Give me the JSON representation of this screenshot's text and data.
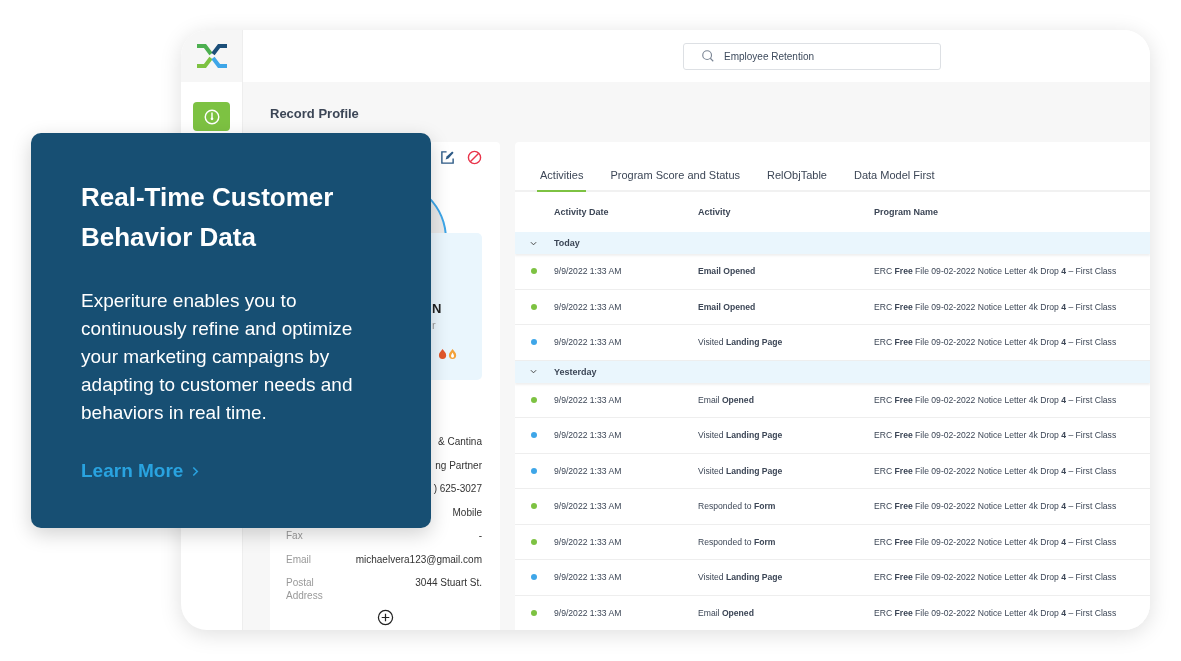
{
  "sidebar": {
    "items": [
      {
        "kind": "dashboard",
        "selected": true
      }
    ]
  },
  "search": {
    "value": "Employee Retention"
  },
  "page_title": "Record Profile",
  "profile": {
    "name_fragment": "N",
    "title_fragment": "r",
    "fields": [
      {
        "value": "& Cantina"
      },
      {
        "value": "ng Partner"
      },
      {
        "value": ") 625-3027"
      },
      {
        "value": "Mobile"
      },
      {
        "label": "Fax",
        "value": "-"
      },
      {
        "label": "Email",
        "value": "michaelvera123@gmail.com"
      },
      {
        "label": "Postal Address",
        "value": "3044 Stuart St."
      }
    ]
  },
  "tabs": [
    {
      "label": "Activities",
      "selected": true
    },
    {
      "label": "Program Score and Status",
      "selected": false
    },
    {
      "label": "RelObjTable",
      "selected": false
    },
    {
      "label": "Data Model First",
      "selected": false
    }
  ],
  "table": {
    "columns": [
      "Activity Date",
      "Activity",
      "Program Name"
    ],
    "groups": [
      {
        "label": "Today",
        "expanded": true,
        "rows": [
          {
            "color": "#7dc242",
            "date": "9/9/2022 1:33 AM",
            "activity": "Email Opened",
            "strong": true,
            "program": "ERC **Free** File 09-02-2022 Notice Letter 4k Drop **4** – First Class"
          },
          {
            "color": "#7dc242",
            "date": "9/9/2022 1:33 AM",
            "activity": "Email Opened",
            "strong": true,
            "program": "ERC **Free** File 09-02-2022 Notice Letter 4k Drop **4** – First Class"
          },
          {
            "color": "#3ea6e8",
            "date": "9/9/2022 1:33 AM",
            "activity": "Visited **Landing Page**",
            "strong": false,
            "program": "ERC **Free** File 09-02-2022 Notice Letter 4k Drop **4** – First Class"
          }
        ]
      },
      {
        "label": "Yesterday",
        "expanded": true,
        "rows": [
          {
            "color": "#7dc242",
            "date": "9/9/2022 1:33 AM",
            "activity": "Email **Opened**",
            "strong": false,
            "program": "ERC **Free** File 09-02-2022 Notice Letter 4k Drop **4** – First Class"
          },
          {
            "color": "#3ea6e8",
            "date": "9/9/2022 1:33 AM",
            "activity": "Visited **Landing Page**",
            "strong": false,
            "program": "ERC **Free** File 09-02-2022 Notice Letter 4k Drop **4** – First Class"
          },
          {
            "color": "#3ea6e8",
            "date": "9/9/2022 1:33 AM",
            "activity": "Visited **Landing Page**",
            "strong": false,
            "program": "ERC **Free** File 09-02-2022 Notice Letter 4k Drop **4** – First Class"
          },
          {
            "color": "#7dc242",
            "date": "9/9/2022 1:33 AM",
            "activity": "Responded to **Form**",
            "strong": false,
            "program": "ERC **Free** File 09-02-2022 Notice Letter 4k Drop **4** – First Class"
          },
          {
            "color": "#7dc242",
            "date": "9/9/2022 1:33 AM",
            "activity": "Responded to **Form**",
            "strong": false,
            "program": "ERC **Free** File 09-02-2022 Notice Letter 4k Drop **4** – First Class"
          },
          {
            "color": "#3ea6e8",
            "date": "9/9/2022 1:33 AM",
            "activity": "Visited **Landing Page**",
            "strong": false,
            "program": "ERC **Free** File 09-02-2022 Notice Letter 4k Drop **4** – First Class"
          },
          {
            "color": "#7dc242",
            "date": "9/9/2022 1:33 AM",
            "activity": "Email **Opened**",
            "strong": false,
            "program": "ERC **Free** File 09-02-2022 Notice Letter 4k Drop **4** – First Class"
          }
        ]
      }
    ]
  },
  "promo": {
    "title": "Real-Time Customer Behavior Data",
    "body": "Experiture enables you to continuously refine and optimize your marketing campaigns by adapting to customer needs and behaviors in real time.",
    "link": "Learn More"
  }
}
